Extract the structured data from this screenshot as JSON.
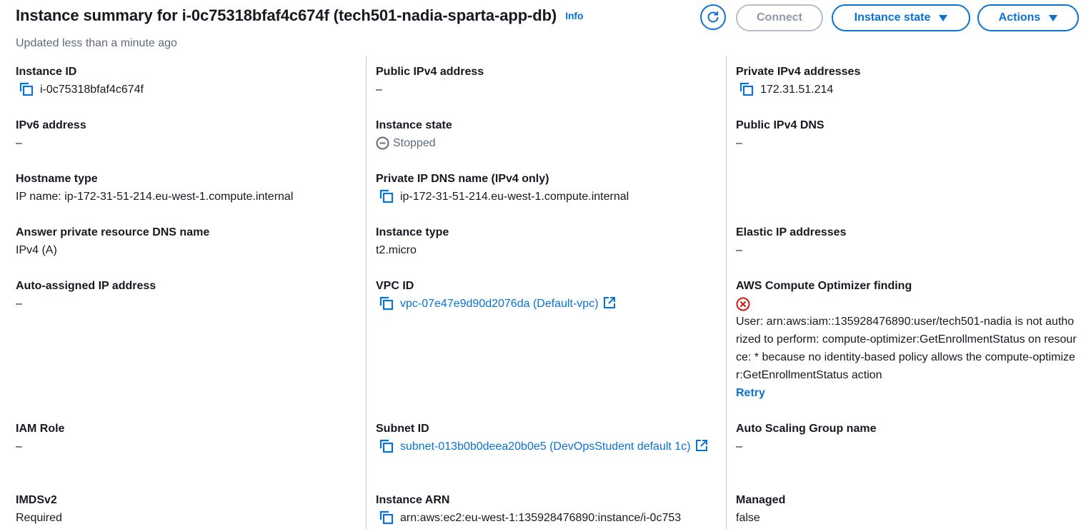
{
  "header": {
    "title": "Instance summary for i-0c75318bfaf4c674f (tech501-nadia-sparta-app-db)",
    "info_label": "Info",
    "subtitle": "Updated less than a minute ago",
    "buttons": {
      "refresh_icon": "refresh-icon",
      "connect": "Connect",
      "instance_state": "Instance state",
      "actions": "Actions"
    }
  },
  "colors": {
    "accent": "#0972d3",
    "text": "#16191f",
    "muted": "#5f6b7a",
    "error": "#d91515",
    "disabled": "#8d99a8"
  },
  "col1": {
    "instance_id": {
      "label": "Instance ID",
      "value": "i-0c75318bfaf4c674f"
    },
    "ipv6": {
      "label": "IPv6 address",
      "value": "–"
    },
    "hostname_type": {
      "label": "Hostname type",
      "value": "IP name: ip-172-31-51-214.eu-west-1.compute.internal"
    },
    "answer_dns": {
      "label": "Answer private resource DNS name",
      "value": "IPv4 (A)"
    },
    "auto_ip": {
      "label": "Auto-assigned IP address",
      "value": "–"
    },
    "iam_role": {
      "label": "IAM Role",
      "value": "–"
    },
    "imdsv2": {
      "label": "IMDSv2",
      "value": "Required"
    }
  },
  "col2": {
    "public_ipv4": {
      "label": "Public IPv4 address",
      "value": "–"
    },
    "instance_state": {
      "label": "Instance state",
      "value": "Stopped"
    },
    "private_dns": {
      "label": "Private IP DNS name (IPv4 only)",
      "value": "ip-172-31-51-214.eu-west-1.compute.internal"
    },
    "instance_type": {
      "label": "Instance type",
      "value": "t2.micro"
    },
    "vpc_id": {
      "label": "VPC ID",
      "value": "vpc-07e47e9d90d2076da (Default-vpc)"
    },
    "subnet_id": {
      "label": "Subnet ID",
      "value": "subnet-013b0b0deea20b0e5 (DevOpsStudent default 1c)"
    },
    "instance_arn": {
      "label": "Instance ARN",
      "value": "arn:aws:ec2:eu-west-1:135928476890:instance/i-0c753"
    }
  },
  "col3": {
    "private_ipv4": {
      "label": "Private IPv4 addresses",
      "value": "172.31.51.214"
    },
    "public_dns": {
      "label": "Public IPv4 DNS",
      "value": "–"
    },
    "elastic_ip": {
      "label": "Elastic IP addresses",
      "value": "–"
    },
    "optimizer": {
      "label": "AWS Compute Optimizer finding",
      "error": "User: arn:aws:iam::135928476890:user/tech501-nadia is not authorized to perform: compute-optimizer:GetEnrollmentStatus on resource: * because no identity-based policy allows the compute-optimizer:GetEnrollmentStatus action",
      "retry": "Retry"
    },
    "asg_name": {
      "label": "Auto Scaling Group name",
      "value": "–"
    },
    "managed": {
      "label": "Managed",
      "value": "false"
    }
  }
}
